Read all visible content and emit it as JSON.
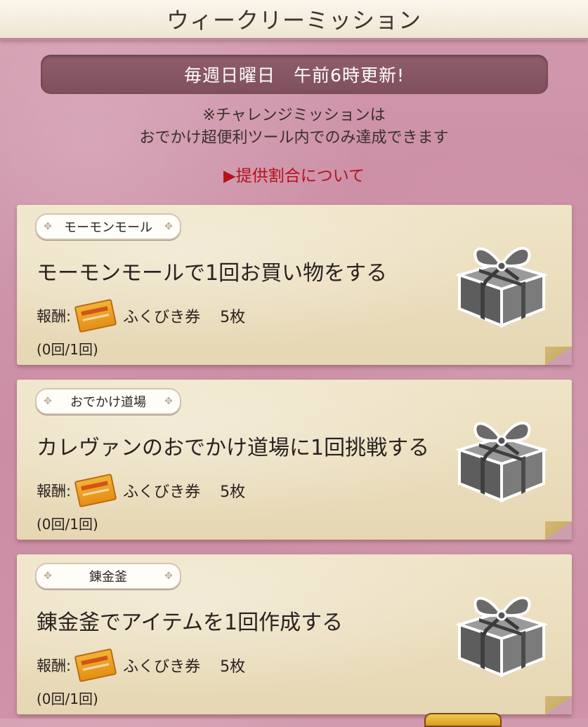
{
  "header": {
    "title": "ウィークリーミッション"
  },
  "banner": {
    "text": "毎週日曜日　午前6時更新!"
  },
  "notice": {
    "line1": "※チャレンジミッションは",
    "line2": "おでかけ超便利ツール内でのみ達成できます"
  },
  "rate_link": {
    "label": "▶提供割合について"
  },
  "colors": {
    "background": "#cf92a8",
    "link": "#b5121b",
    "card": "#e8dab8"
  },
  "missions": [
    {
      "tag": "モーモンモール",
      "title": "モーモンモールで1回お買い物をする",
      "reward_label": "報酬:",
      "reward_icon": "ticket-icon",
      "reward_name": "ふくびき券",
      "reward_count": "5枚",
      "progress": "(0回/1回)",
      "gift_icon": "gift-box-icon"
    },
    {
      "tag": "おでかけ道場",
      "title": "カレヴァンのおでかけ道場に1回挑戦する",
      "reward_label": "報酬:",
      "reward_icon": "ticket-icon",
      "reward_name": "ふくびき券",
      "reward_count": "5枚",
      "progress": "(0回/1回)",
      "gift_icon": "gift-box-icon"
    },
    {
      "tag": "錬金釜",
      "title": "錬金釜でアイテムを1回作成する",
      "reward_label": "報酬:",
      "reward_icon": "ticket-icon",
      "reward_name": "ふくびき券",
      "reward_count": "5枚",
      "progress": "(0回/1回)",
      "gift_icon": "gift-box-icon"
    }
  ]
}
